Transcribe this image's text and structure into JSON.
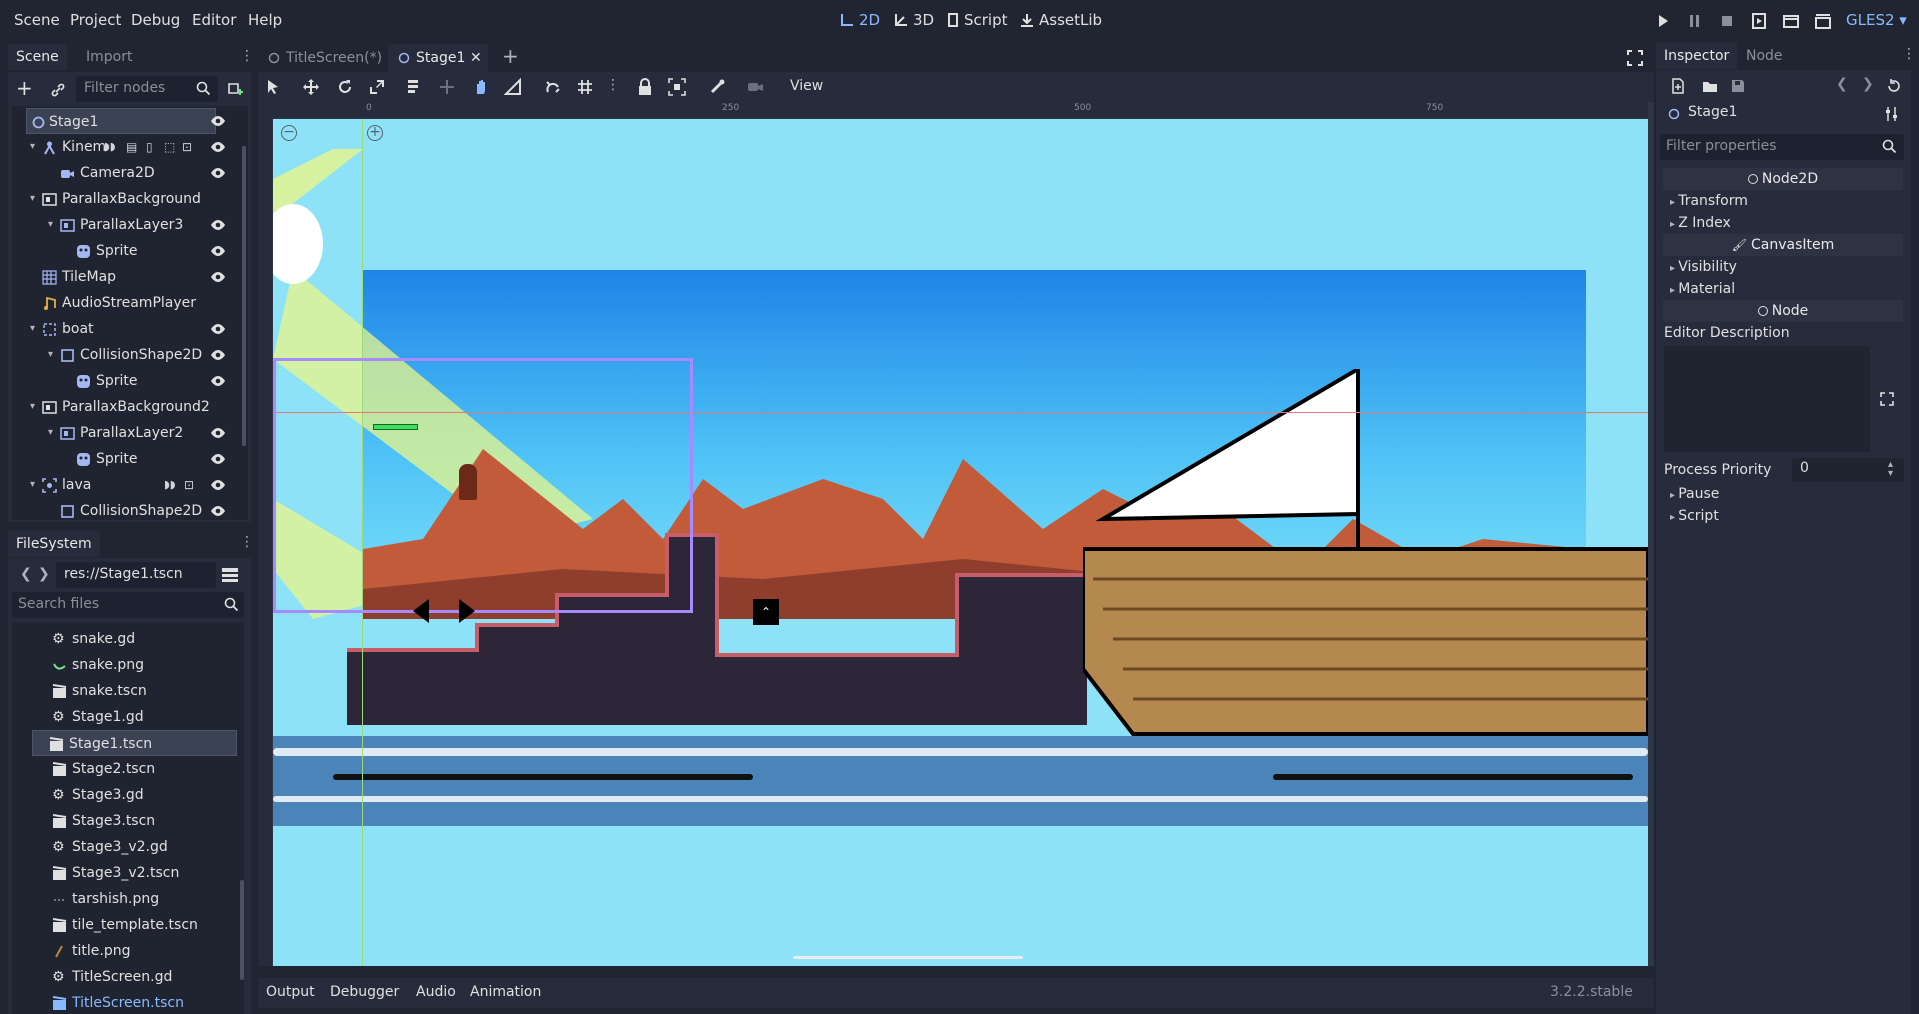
{
  "menubar": {
    "items": [
      "Scene",
      "Project",
      "Debug",
      "Editor",
      "Help"
    ],
    "modes": [
      "2D",
      "3D",
      "Script",
      "AssetLib"
    ],
    "active_mode": "2D",
    "renderer": "GLES2"
  },
  "scene_dock": {
    "tabs": [
      "Scene",
      "Import"
    ],
    "filter_placeholder": "Filter nodes",
    "nodes": [
      {
        "label": "Stage1",
        "icon": "node2d-icon",
        "selected": true
      },
      {
        "label": "Kinem",
        "icon": "kinematic-body-icon"
      },
      {
        "label": "Camera2D",
        "icon": "camera-icon"
      },
      {
        "label": "ParallaxBackground",
        "icon": "parallax-icon"
      },
      {
        "label": "ParallaxLayer3",
        "icon": "parallax-layer-icon"
      },
      {
        "label": "Sprite",
        "icon": "sprite-icon"
      },
      {
        "label": "TileMap",
        "icon": "tilemap-icon"
      },
      {
        "label": "AudioStreamPlayer",
        "icon": "audio-icon"
      },
      {
        "label": "boat",
        "icon": "static-body-icon"
      },
      {
        "label": "CollisionShape2D",
        "icon": "collision-shape-icon"
      },
      {
        "label": "Sprite",
        "icon": "sprite-icon"
      },
      {
        "label": "ParallaxBackground2",
        "icon": "parallax-icon"
      },
      {
        "label": "ParallaxLayer2",
        "icon": "parallax-layer-icon"
      },
      {
        "label": "Sprite",
        "icon": "sprite-icon"
      },
      {
        "label": "lava",
        "icon": "area-icon"
      },
      {
        "label": "CollisionShape2D",
        "icon": "collision-shape-icon"
      }
    ]
  },
  "filesystem": {
    "tab": "FileSystem",
    "path": "res://Stage1.tscn",
    "search_placeholder": "Search files",
    "files": [
      {
        "label": "snake.gd",
        "icon": "gear-icon"
      },
      {
        "label": "snake.png",
        "icon": "image-icon"
      },
      {
        "label": "snake.tscn",
        "icon": "scene-icon"
      },
      {
        "label": "Stage1.gd",
        "icon": "gear-icon"
      },
      {
        "label": "Stage1.tscn",
        "icon": "scene-icon",
        "selected": true
      },
      {
        "label": "Stage2.tscn",
        "icon": "scene-icon"
      },
      {
        "label": "Stage3.gd",
        "icon": "gear-icon"
      },
      {
        "label": "Stage3.tscn",
        "icon": "scene-icon"
      },
      {
        "label": "Stage3_v2.gd",
        "icon": "gear-icon"
      },
      {
        "label": "Stage3_v2.tscn",
        "icon": "scene-icon"
      },
      {
        "label": "tarshish.png",
        "icon": "image-icon"
      },
      {
        "label": "tile_template.tscn",
        "icon": "scene-icon"
      },
      {
        "label": "title.png",
        "icon": "image-icon"
      },
      {
        "label": "TitleScreen.gd",
        "icon": "gear-icon"
      },
      {
        "label": "TitleScreen.tscn",
        "icon": "scene-icon"
      }
    ]
  },
  "editor": {
    "tabs": [
      "TitleScreen(*)",
      "Stage1"
    ],
    "active_tab": "Stage1",
    "view_menu": "View",
    "ruler_labels": [
      "0",
      "250",
      "500",
      "750"
    ],
    "zoom_labels": [
      "−",
      "+"
    ],
    "bottom_tabs": [
      "Output",
      "Debugger",
      "Audio",
      "Animation"
    ],
    "version": "3.2.2.stable"
  },
  "inspector": {
    "tabs": [
      "Inspector",
      "Node"
    ],
    "node_name": "Stage1",
    "filter_placeholder": "Filter properties",
    "sections": {
      "node2d": "Node2D",
      "transform": "Transform",
      "zindex": "Z Index",
      "canvasitem": "CanvasItem",
      "visibility": "Visibility",
      "material": "Material",
      "node": "Node",
      "editor_description": "Editor Description",
      "process_priority": "Process Priority",
      "process_priority_value": "0",
      "pause": "Pause",
      "script": "Script"
    }
  },
  "colors": {
    "accent": "#8ab9ff",
    "panel_bg": "#262c3b",
    "window_bg": "#202531",
    "sky": "#8ee2f7"
  }
}
